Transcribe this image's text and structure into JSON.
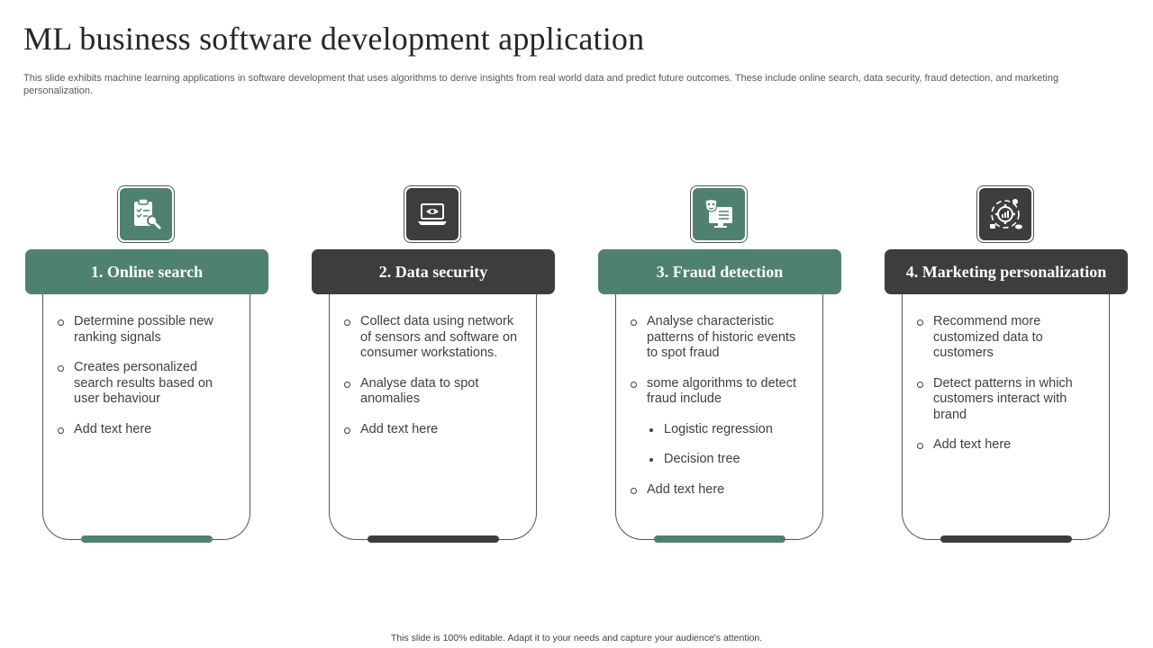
{
  "slide": {
    "title": "ML business software development application",
    "subtitle": "This slide exhibits machine learning applications in software development that uses algorithms to derive insights from real world data and predict future outcomes. These include online search, data security, fraud detection, and marketing personalization.",
    "footer": "This slide is 100% editable.  Adapt it to your needs and capture your audience's attention."
  },
  "colors": {
    "green": "#4f8170",
    "dark": "#3d3d3d"
  },
  "cards": [
    {
      "title": "1. Online search",
      "icon": "clipboard-search-icon",
      "theme": "green",
      "points": [
        "Determine possible new ranking signals",
        "Creates personalized search results based on user behaviour",
        "Add text here"
      ]
    },
    {
      "title": "2. Data security",
      "icon": "laptop-eye-icon",
      "theme": "dark",
      "points": [
        "Collect data using network of sensors and software on consumer workstations.",
        " Analyse data to spot anomalies",
        "Add text here"
      ]
    },
    {
      "title": "3. Fraud detection",
      "icon": "mask-monitor-icon",
      "theme": "green",
      "points": [
        "Analyse characteristic patterns of historic events to spot fraud",
        "some algorithms to detect fraud include",
        "Add text here"
      ],
      "subpoints": [
        "Logistic regression",
        "Decision tree"
      ]
    },
    {
      "title": "4. Marketing personalization",
      "icon": "marketing-gear-icon",
      "theme": "dark",
      "points": [
        "Recommend more customized data to customers",
        "Detect patterns in which customers interact with brand",
        "Add text here"
      ]
    }
  ]
}
